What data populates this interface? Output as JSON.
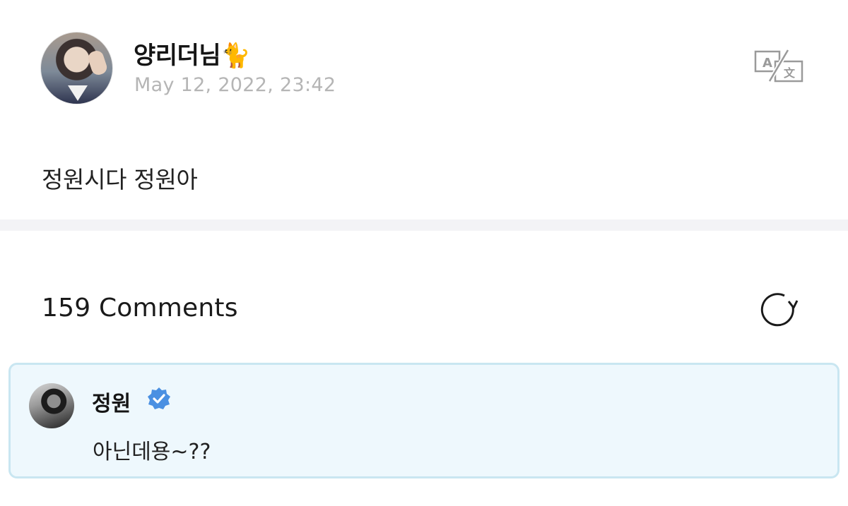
{
  "post": {
    "author_name": "양리더님",
    "author_emoji": "🐈",
    "date": "May 12, 2022, 23:42",
    "body": "정원시다 정원아",
    "translate_icon": "translate-icon"
  },
  "comments": {
    "count_label": "159 Comments",
    "refresh_icon": "refresh-icon",
    "highlighted": {
      "author": "정원",
      "verified_icon": "verified-badge-icon",
      "text": "아닌데용~??"
    }
  },
  "colors": {
    "date_gray": "#b5b5b5",
    "comment_bg": "#eef8fd",
    "comment_border": "#c9e6f1",
    "verified_blue": "#4a90e2",
    "divider": "#f3f3f6"
  }
}
